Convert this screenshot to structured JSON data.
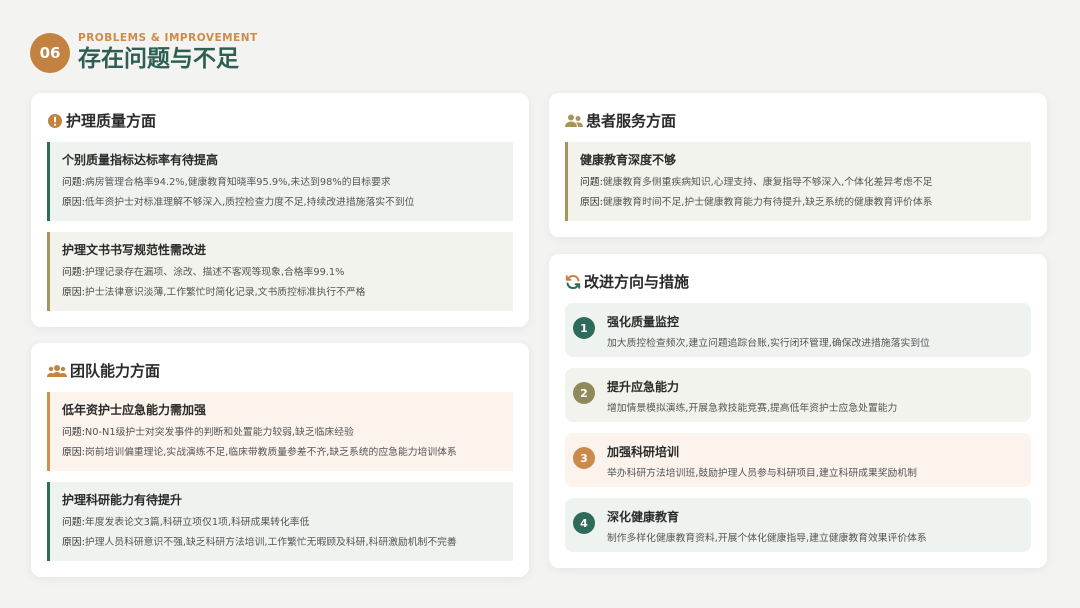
{
  "header": {
    "number": "06",
    "subtitle": "PROBLEMS & IMPROVEMENT",
    "title": "存在问题与不足"
  },
  "nursing_quality": {
    "title": "护理质量方面",
    "icon": "info-circle-icon",
    "items": [
      {
        "title": "个别质量指标达标率有待提高",
        "problem_label": "问题:",
        "problem": "病房管理合格率94.2%,健康教育知晓率95.9%,未达到98%的目标要求",
        "cause_label": "原因:",
        "cause": "低年资护士对标准理解不够深入,质控检查力度不足,持续改进措施落实不到位"
      },
      {
        "title": "护理文书书写规范性需改进",
        "problem_label": "问题:",
        "problem": "护理记录存在漏项、涂改、描述不客观等现象,合格率99.1%",
        "cause_label": "原因:",
        "cause": "护士法律意识淡薄,工作繁忙时简化记录,文书质控标准执行不严格"
      }
    ]
  },
  "team_ability": {
    "title": "团队能力方面",
    "icon": "users-icon",
    "items": [
      {
        "title": "低年资护士应急能力需加强",
        "problem_label": "问题:",
        "problem": "N0-N1级护士对突发事件的判断和处置能力较弱,缺乏临床经验",
        "cause_label": "原因:",
        "cause": "岗前培训偏重理论,实战演练不足,临床带教质量参差不齐,缺乏系统的应急能力培训体系"
      },
      {
        "title": "护理科研能力有待提升",
        "problem_label": "问题:",
        "problem": "年度发表论文3篇,科研立项仅1项,科研成果转化率低",
        "cause_label": "原因:",
        "cause": "护理人员科研意识不强,缺乏科研方法培训,工作繁忙无暇顾及科研,科研激励机制不完善"
      }
    ]
  },
  "patient_service": {
    "title": "患者服务方面",
    "icon": "patients-icon",
    "items": [
      {
        "title": "健康教育深度不够",
        "problem_label": "问题:",
        "problem": "健康教育多侧重疾病知识,心理支持、康复指导不够深入,个体化差异考虑不足",
        "cause_label": "原因:",
        "cause": "健康教育时间不足,护士健康教育能力有待提升,缺乏系统的健康教育评价体系"
      }
    ]
  },
  "improvement": {
    "title": "改进方向与措施",
    "icon": "refresh-icon",
    "items": [
      {
        "num": "1",
        "title": "强化质量监控",
        "desc": "加大质控检查频次,建立问题追踪台账,实行闭环管理,确保改进措施落实到位",
        "color": "#2e6b5b"
      },
      {
        "num": "2",
        "title": "提升应急能力",
        "desc": "增加情景模拟演练,开展急救技能竞赛,提高低年资护士应急处置能力",
        "color": "#8f8a5d"
      },
      {
        "num": "3",
        "title": "加强科研培训",
        "desc": "举办科研方法培训班,鼓励护理人员参与科研项目,建立科研成果奖励机制",
        "color": "#c98a4a"
      },
      {
        "num": "4",
        "title": "深化健康教育",
        "desc": "制作多样化健康教育资料,开展个体化健康指导,建立健康教育效果评价体系",
        "color": "#2e6b5b"
      }
    ]
  },
  "colors": {
    "primary": "#2e5f52",
    "accent": "#c38240",
    "gold": "#a8955a",
    "background": "#f3f4f2"
  }
}
